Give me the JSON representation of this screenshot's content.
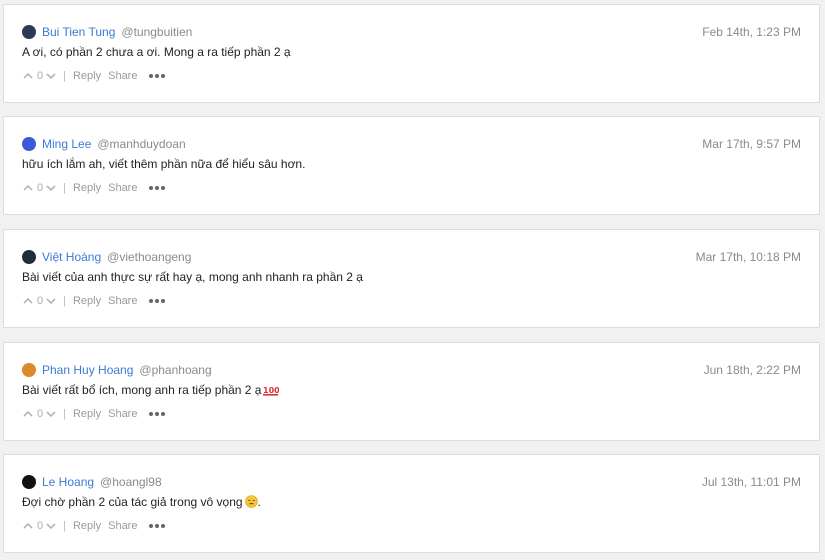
{
  "comments": [
    {
      "author": "Bui Tien Tung",
      "handle": "@tungbuitien",
      "time": "Feb 14th, 1:23 PM",
      "text": "A ơi, có phần 2 chưa a ơi. Mong a ra tiếp phần 2 ạ",
      "votes": "0",
      "avatar_color": "#2b3a55",
      "emoji_icon": ""
    },
    {
      "author": "Ming Lee",
      "handle": "@manhduydoan",
      "time": "Mar 17th, 9:57 PM",
      "text": "hữu ích lắm ah, viết thêm phần nữa để hiểu sâu hơn.",
      "votes": "0",
      "avatar_color": "#3b5bd6",
      "emoji_icon": ""
    },
    {
      "author": "Việt Hoàng",
      "handle": "@viethoangeng",
      "time": "Mar 17th, 10:18 PM",
      "text": "Bài viết của anh thực sự rất hay ạ, mong anh nhanh ra phần 2 ạ",
      "votes": "0",
      "avatar_color": "#1f2d3d",
      "emoji_icon": ""
    },
    {
      "author": "Phan Huy Hoang",
      "handle": "@phanhoang",
      "time": "Jun 18th, 2:22 PM",
      "text": "Bài viết rất bổ ích, mong anh ra tiếp phần 2 ạ",
      "votes": "0",
      "avatar_color": "#d98b2b",
      "emoji_icon": "hundred-points-icon"
    },
    {
      "author": "Le Hoang",
      "handle": "@hoangl98",
      "time": "Jul 13th, 11:01 PM",
      "text": "Đợi chờ phần 2 của tác giả trong vô vọng",
      "text_suffix": ".",
      "votes": "0",
      "avatar_color": "#111111",
      "emoji_icon": "pensive-face-icon"
    }
  ],
  "actions": {
    "reply_label": "Reply",
    "share_label": "Share",
    "separator": "|"
  },
  "colors": {
    "link": "#3a7bd5",
    "muted": "#8a8a8a",
    "card_border": "#dcdcdc",
    "background": "#f1f1f1"
  }
}
